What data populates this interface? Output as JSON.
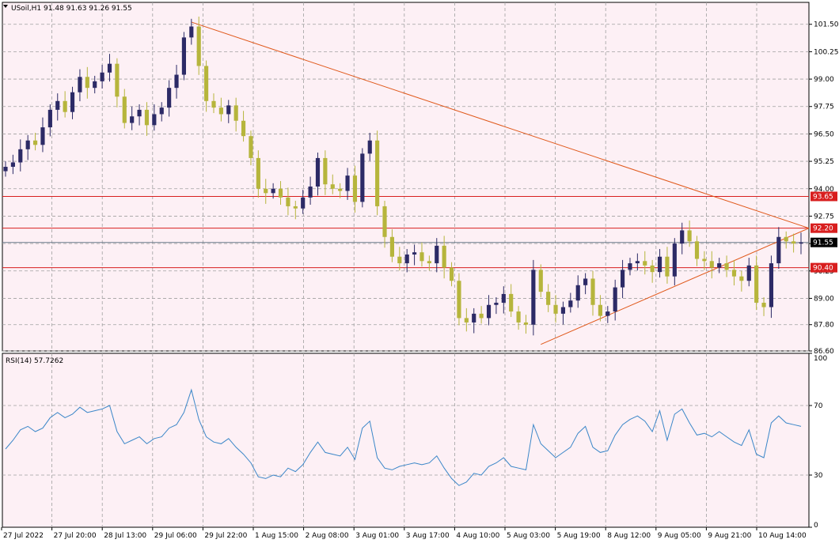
{
  "window": {
    "symbol_header": "USoil,H1  91.48 91.63 91.26 91.55",
    "rsi_header": "RSI(14) 57.7262"
  },
  "colors": {
    "background": "#fdf0f5",
    "grid": "#a0a0a0",
    "bull_candle": "#2c2a66",
    "bear_candle": "#b6b53c",
    "wick": "#555555",
    "trendline": "#e0581a",
    "level_line": "#d81e1e",
    "current_price_line": "#6b7b8c",
    "rsi_line": "#3a86c8"
  },
  "chart_data": [
    {
      "type": "candlestick",
      "panel": "price",
      "title": "USoil,H1",
      "ohlc_header": {
        "open": 91.48,
        "high": 91.63,
        "low": 91.26,
        "close": 91.55
      },
      "ylim": [
        86.6,
        102.5
      ],
      "y_ticks": [
        "101.50",
        "100.25",
        "99.00",
        "97.75",
        "96.50",
        "95.25",
        "94.00",
        "92.75",
        "91.50",
        "90.25",
        "89.00",
        "87.80",
        "86.60"
      ],
      "x_ticks": [
        "27 Jul 2022",
        "27 Jul 20:00",
        "28 Jul 13:00",
        "29 Jul 06:00",
        "29 Jul 22:00",
        "1 Aug 15:00",
        "2 Aug 08:00",
        "3 Aug 01:00",
        "3 Aug 17:00",
        "4 Aug 10:00",
        "5 Aug 03:00",
        "5 Aug 19:00",
        "8 Aug 12:00",
        "9 Aug 05:00",
        "9 Aug 21:00",
        "10 Aug 14:00"
      ],
      "close_path": [
        95.0,
        95.2,
        95.8,
        96.2,
        96.0,
        96.8,
        97.6,
        98.0,
        97.5,
        98.4,
        99.1,
        98.6,
        98.9,
        99.3,
        99.7,
        98.2,
        97.0,
        97.3,
        97.6,
        96.9,
        97.4,
        97.7,
        98.6,
        99.2,
        100.9,
        101.4,
        99.6,
        98.0,
        97.7,
        97.4,
        97.8,
        97.1,
        96.4,
        95.4,
        94.0,
        93.8,
        94.0,
        93.6,
        93.2,
        93.1,
        93.6,
        94.1,
        95.4,
        94.2,
        94.0,
        93.9,
        94.6,
        93.4,
        95.6,
        96.2,
        93.2,
        91.8,
        90.9,
        90.6,
        91.0,
        91.1,
        90.7,
        90.6,
        91.4,
        90.4,
        89.8,
        88.1,
        87.9,
        88.3,
        88.1,
        88.7,
        88.8,
        89.2,
        88.4,
        87.9,
        87.8,
        90.3,
        89.3,
        88.7,
        88.3,
        88.6,
        88.9,
        89.6,
        89.9,
        88.7,
        88.2,
        88.4,
        89.5,
        90.3,
        90.6,
        90.7,
        90.5,
        90.2,
        90.9,
        90.0,
        91.5,
        92.1,
        91.6,
        90.8,
        90.7,
        90.4,
        90.6,
        90.3,
        90.0,
        89.8,
        90.5,
        88.8,
        88.6,
        90.6,
        91.8,
        91.6,
        91.5,
        91.55
      ],
      "reference_lines": [
        93.65,
        92.2,
        90.4
      ],
      "reference_labels": [
        "93.65",
        "92.20",
        "90.40"
      ],
      "current_price": 91.55,
      "current_price_label": "91.55",
      "trendlines": [
        {
          "from_bar": 25,
          "from_price": 101.6,
          "to_bar": 110,
          "to_price": 92.2
        },
        {
          "from_bar": 72,
          "from_price": 86.9,
          "to_bar": 110,
          "to_price": 92.2
        }
      ]
    },
    {
      "type": "line",
      "panel": "indicator",
      "title": "RSI(14) 57.7262",
      "ylim": [
        0,
        100
      ],
      "y_ticks": [
        "100",
        "70",
        "30",
        "0"
      ],
      "levels": [
        70,
        30
      ],
      "values": [
        45,
        50,
        56,
        58,
        55,
        57,
        63,
        66,
        63,
        65,
        69,
        66,
        67,
        68,
        70,
        55,
        48,
        50,
        52,
        48,
        51,
        52,
        57,
        59,
        66,
        79,
        62,
        52,
        49,
        48,
        51,
        46,
        42,
        37,
        29,
        28,
        30,
        29,
        34,
        32,
        36,
        43,
        49,
        43,
        42,
        41,
        46,
        39,
        57,
        61,
        40,
        34,
        33,
        35,
        36,
        37,
        36,
        37,
        41,
        34,
        28,
        24,
        26,
        31,
        30,
        35,
        37,
        40,
        35,
        34,
        33,
        59,
        48,
        44,
        40,
        43,
        46,
        54,
        58,
        46,
        43,
        44,
        53,
        59,
        62,
        64,
        61,
        55,
        67,
        50,
        65,
        68,
        60,
        53,
        54,
        52,
        55,
        52,
        49,
        47,
        56,
        42,
        40,
        60,
        64,
        60,
        59,
        58
      ]
    }
  ]
}
